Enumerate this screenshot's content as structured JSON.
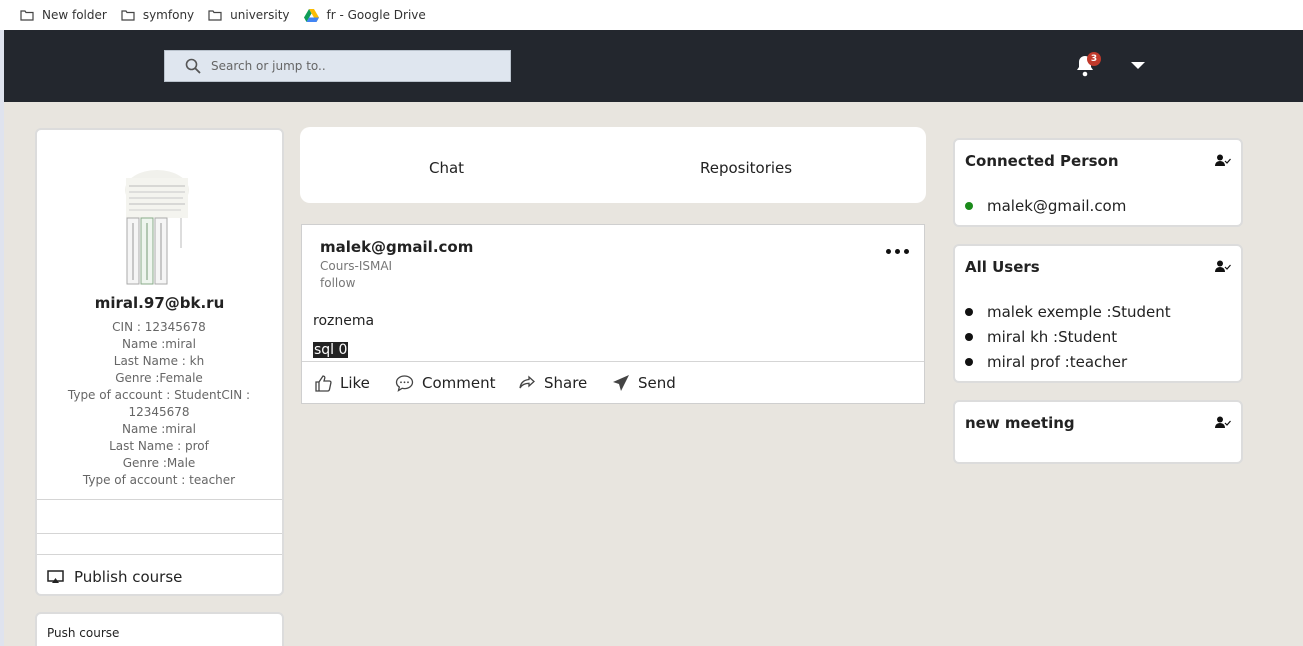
{
  "bookmarks": [
    {
      "label": "New folder",
      "icon": "folder-icon"
    },
    {
      "label": "symfony",
      "icon": "folder-icon"
    },
    {
      "label": "university",
      "icon": "folder-icon"
    },
    {
      "label": "fr - Google Drive",
      "icon": "google-drive-icon"
    }
  ],
  "header": {
    "search_placeholder": "Search or jump to..",
    "notification_count": "3"
  },
  "profile": {
    "email": "miral.97@bk.ru",
    "details": [
      "CIN : 12345678",
      "Name :miral",
      "Last Name : kh",
      "Genre :Female",
      "Type of account : StudentCIN : 12345678",
      "Name :miral",
      "Last Name : prof",
      "Genre :Male",
      "Type of account : teacher"
    ],
    "publish_label": "Publish course",
    "push_label": "Push course"
  },
  "tabs": {
    "chat": "Chat",
    "repositories": "Repositories"
  },
  "post": {
    "author": "malek@gmail.com",
    "course": "Cours-ISMAI",
    "follow": "follow",
    "text": "roznema",
    "selected_text": "sql 0",
    "actions": {
      "like": "Like",
      "comment": "Comment",
      "share": "Share",
      "send": "Send"
    }
  },
  "connected": {
    "title": "Connected Person",
    "users": [
      "malek@gmail.com"
    ],
    "status_color": "#1a8a1a"
  },
  "all_users": {
    "title": "All Users",
    "users": [
      "malek exemple :Student",
      "miral kh :Student",
      "miral prof :teacher"
    ]
  },
  "meeting": {
    "title": "new meeting"
  },
  "colors": {
    "navbar": "#23272e",
    "page_bg": "#e8e5df",
    "badge": "#c0392b"
  }
}
